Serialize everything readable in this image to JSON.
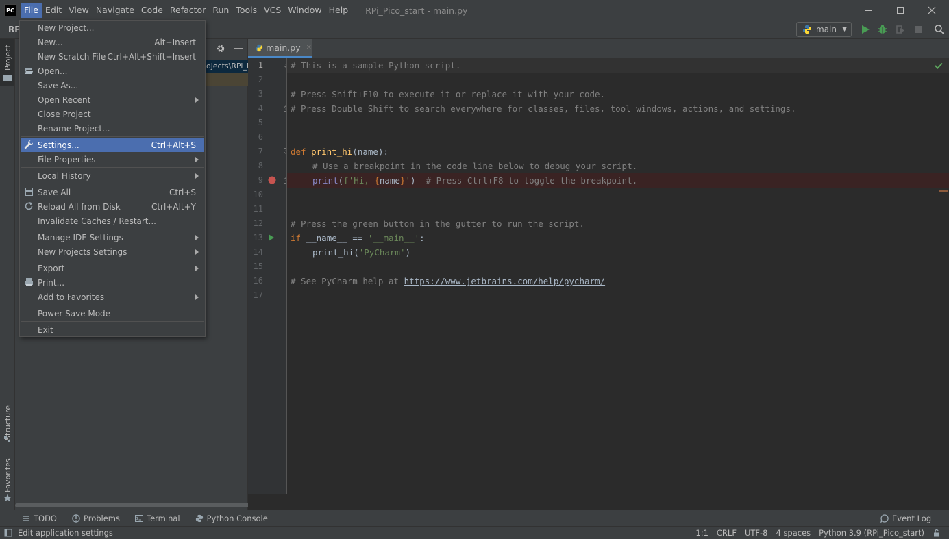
{
  "menubar": {
    "logo": "PC",
    "items": [
      "File",
      "Edit",
      "View",
      "Navigate",
      "Code",
      "Refactor",
      "Run",
      "Tools",
      "VCS",
      "Window",
      "Help"
    ],
    "active_item": "File",
    "window_title": "RPi_Pico_start - main.py"
  },
  "toolbar": {
    "breadcrumb_root": "RPi",
    "run_config": "main"
  },
  "left_stripe": {
    "project_tab": "Project",
    "structure_tab": "Structure",
    "favorites_tab": "Favorites"
  },
  "project_panel": {
    "path_fragment": "ojects\\RPi_P"
  },
  "file_menu": {
    "items": [
      {
        "label": "New Project...",
        "shortcut": ""
      },
      {
        "label": "New...",
        "shortcut": "Alt+Insert"
      },
      {
        "label": "New Scratch File",
        "shortcut": "Ctrl+Alt+Shift+Insert"
      },
      {
        "label": "Open...",
        "shortcut": ""
      },
      {
        "label": "Save As...",
        "shortcut": ""
      },
      {
        "label": "Open Recent",
        "shortcut": ""
      },
      {
        "label": "Close Project",
        "shortcut": ""
      },
      {
        "label": "Rename Project...",
        "shortcut": ""
      },
      {
        "label": "Settings...",
        "shortcut": "Ctrl+Alt+S"
      },
      {
        "label": "File Properties",
        "shortcut": ""
      },
      {
        "label": "Local History",
        "shortcut": ""
      },
      {
        "label": "Save All",
        "shortcut": "Ctrl+S"
      },
      {
        "label": "Reload All from Disk",
        "shortcut": "Ctrl+Alt+Y"
      },
      {
        "label": "Invalidate Caches / Restart...",
        "shortcut": ""
      },
      {
        "label": "Manage IDE Settings",
        "shortcut": ""
      },
      {
        "label": "New Projects Settings",
        "shortcut": ""
      },
      {
        "label": "Export",
        "shortcut": ""
      },
      {
        "label": "Print...",
        "shortcut": ""
      },
      {
        "label": "Add to Favorites",
        "shortcut": ""
      },
      {
        "label": "Power Save Mode",
        "shortcut": ""
      },
      {
        "label": "Exit",
        "shortcut": ""
      }
    ],
    "selected": "Settings..."
  },
  "editor": {
    "tab_label": "main.py",
    "line_numbers": [
      "1",
      "2",
      "3",
      "4",
      "5",
      "6",
      "7",
      "8",
      "9",
      "10",
      "11",
      "12",
      "13",
      "14",
      "15",
      "16",
      "17"
    ],
    "lines": {
      "l1": "# This is a sample Python script.",
      "l3": "# Press Shift+F10 to execute it or replace it with your code.",
      "l4": "# Press Double Shift to search everywhere for classes, files, tool windows, actions, and settings.",
      "l7_kw": "def",
      "l7_fn": "print_hi",
      "l7_rest": "(name):",
      "l8": "# Use a breakpoint in the code line below to debug your script.",
      "l9_fn": "print",
      "l9_open": "(",
      "l9_str1": "f'Hi, ",
      "l9_brace_open": "{",
      "l9_name": "name",
      "l9_brace_close": "}",
      "l9_str2": "'",
      "l9_close": ")",
      "l9_comment": "# Press Ctrl+F8 to toggle the breakpoint.",
      "l12": "# Press the green button in the gutter to run the script.",
      "l13_kw": "if",
      "l13_mid": " __name__ == ",
      "l13_str": "'__main__'",
      "l13_end": ":",
      "l14_fn": "print_hi",
      "l14_open": "(",
      "l14_str": "'PyCharm'",
      "l14_close": ")",
      "l16_comment": "# See PyCharm help at ",
      "l16_link": "https://www.jetbrains.com/help/pycharm/"
    }
  },
  "bottom_stripe": {
    "todo": "TODO",
    "problems": "Problems",
    "terminal": "Terminal",
    "python_console": "Python Console",
    "event_log": "Event Log"
  },
  "statusbar": {
    "message": "Edit application settings",
    "position": "1:1",
    "line_sep": "CRLF",
    "encoding": "UTF-8",
    "indent": "4 spaces",
    "interpreter": "Python 3.9 (RPi_Pico_start)"
  },
  "colors": {
    "menu_selection": "#4b6eaf",
    "breakpoint": "#c75450",
    "run_green": "#499c54",
    "inspection_ok": "#5ca35c"
  }
}
